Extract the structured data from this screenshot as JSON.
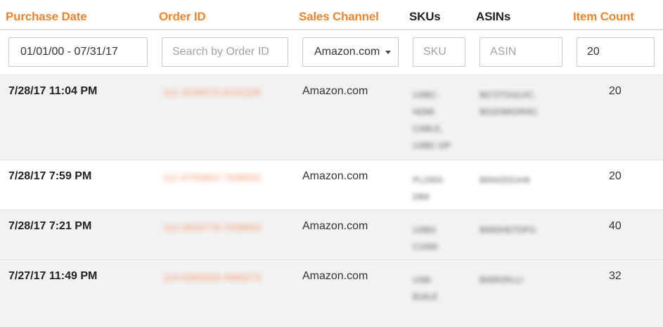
{
  "columns": {
    "purchase_date": "Purchase Date",
    "order_id": "Order ID",
    "sales_channel": "Sales Channel",
    "skus": "SKUs",
    "asins": "ASINs",
    "item_count": "Item Count"
  },
  "filters": {
    "date_range": "01/01/00 - 07/31/17",
    "order_search_placeholder": "Search by Order ID",
    "sales_channel_selected": "Amazon.com",
    "sku_placeholder": "SKU",
    "asin_placeholder": "ASIN",
    "item_count_value": "20"
  },
  "rows": [
    {
      "purchase_date": "7/28/17 11:04 PM",
      "order_id": "111-3039570-9152228",
      "sales_channel": "Amazon.com",
      "skus": [
        "USBC-",
        "HDMI",
        "CABLE,",
        "USBC-DP"
      ],
      "asins": [
        "B072TGGLVC,",
        "B01EWKDRAC"
      ],
      "item_count": "20"
    },
    {
      "purchase_date": "7/28/17 7:59 PM",
      "order_id": "111-6750902-7938650",
      "sales_channel": "Amazon.com",
      "skus": [
        "PL2303-",
        "DB9"
      ],
      "asins": [
        "B00425S1H8"
      ],
      "item_count": "20"
    },
    {
      "purchase_date": "7/28/17 7:21 PM",
      "order_id": "112-3504779-7938650",
      "sales_channel": "Amazon.com",
      "skus": [
        "USB3-",
        "C1000"
      ],
      "asins": [
        "B00DHDTDFG"
      ],
      "item_count": "40"
    },
    {
      "purchase_date": "7/27/17 11:49 PM",
      "order_id": "113-0095563-4680272",
      "sales_channel": "Amazon.com",
      "skus": [
        "USB-",
        "B16LE"
      ],
      "asins": [
        "B00RZKLLI"
      ],
      "item_count": "32"
    }
  ],
  "colors": {
    "accent_orange": "#f0842c",
    "row_shade": "#f2f2f2"
  }
}
